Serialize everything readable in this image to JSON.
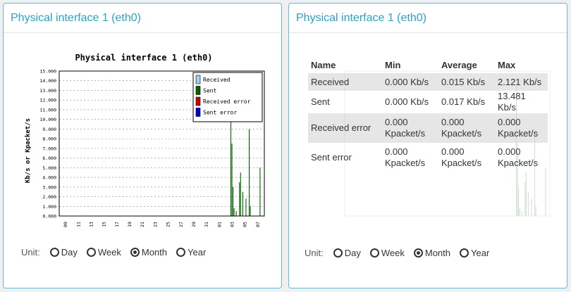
{
  "panels": {
    "left": {
      "title": "Physical interface 1 (eth0)"
    },
    "right": {
      "title": "Physical interface 1 (eth0)"
    }
  },
  "chart_data": {
    "type": "bar",
    "title": "Physical interface 1 (eth0)",
    "ylabel": "Kb/s or Kpacket/s",
    "xlabel": "",
    "ylim": [
      0,
      15
    ],
    "yticks": [
      "0.000",
      "1.000",
      "2.000",
      "3.000",
      "4.000",
      "5.000",
      "6.000",
      "7.000",
      "8.000",
      "9.000",
      "10.000",
      "11.000",
      "12.000",
      "13.000",
      "14.000",
      "15.000"
    ],
    "xticks": [
      "09",
      "11",
      "13",
      "15",
      "17",
      "19",
      "21",
      "23",
      "25",
      "27",
      "29",
      "31",
      "01",
      "03",
      "05",
      "07"
    ],
    "legend": [
      "Received",
      "Sent",
      "Received error",
      "Sent error"
    ],
    "legend_colors": [
      "#9fd3ea",
      "#006400",
      "#cc0000",
      "#0000cc"
    ],
    "legend_position": "top-right",
    "grid": true,
    "series": [
      {
        "name": "Sent",
        "values": [
          {
            "x": 15.9,
            "y": 13.5
          },
          {
            "x": 16.0,
            "y": 7.5
          },
          {
            "x": 16.1,
            "y": 3.0
          },
          {
            "x": 16.2,
            "y": 0.8
          },
          {
            "x": 16.4,
            "y": 0.5
          },
          {
            "x": 16.7,
            "y": 3.5
          },
          {
            "x": 16.8,
            "y": 4.5
          },
          {
            "x": 17.0,
            "y": 2.5
          },
          {
            "x": 17.3,
            "y": 1.8
          },
          {
            "x": 17.6,
            "y": 9.0
          },
          {
            "x": 17.7,
            "y": 1.0
          },
          {
            "x": 18.6,
            "y": 5.0
          }
        ]
      },
      {
        "name": "Received",
        "values": []
      },
      {
        "name": "Received error",
        "values": []
      },
      {
        "name": "Sent error",
        "values": []
      }
    ]
  },
  "stats": {
    "headers": {
      "name": "Name",
      "min": "Min",
      "avg": "Average",
      "max": "Max"
    },
    "rows": [
      {
        "name": "Received",
        "min": "0.000 Kb/s",
        "avg": "0.015 Kb/s",
        "max": "2.121 Kb/s"
      },
      {
        "name": "Sent",
        "min": "0.000 Kb/s",
        "avg": "0.017 Kb/s",
        "max": "13.481 Kb/s"
      },
      {
        "name": "Received error",
        "min": "0.000 Kpacket/s",
        "avg": "0.000 Kpacket/s",
        "max": "0.000 Kpacket/s"
      },
      {
        "name": "Sent error",
        "min": "0.000 Kpacket/s",
        "avg": "0.000 Kpacket/s",
        "max": "0.000 Kpacket/s"
      }
    ]
  },
  "unit_selector": {
    "label": "Unit:",
    "options": [
      "Day",
      "Week",
      "Month",
      "Year"
    ],
    "selected": "Month"
  }
}
